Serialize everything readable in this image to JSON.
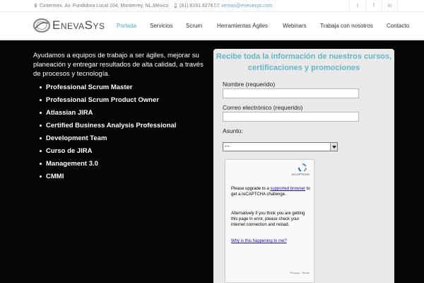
{
  "topbar": {
    "address": "Cintermex. Av. Fundidora Local 104, Monterrey, NL,México",
    "phone": "(81) 8191 8276",
    "email": "ventas@enevasys.com",
    "social": [
      {
        "name": "twitter-icon",
        "glyph": "t"
      },
      {
        "name": "facebook-icon",
        "glyph": "f"
      },
      {
        "name": "linkedin-icon",
        "glyph": "in"
      }
    ]
  },
  "header": {
    "logo_text": "EnevaSys",
    "nav": [
      "Portada",
      "Servicios",
      "Scrum",
      "Herramientas Ágiles",
      "Webinars",
      "Trabaja con nosotros",
      "Contacto"
    ],
    "active_index": 0,
    "accent_color": "#4ab2c3"
  },
  "main": {
    "intro": "Ayudamos a equipos de trabajo a ser ágiles, mejorar su planeación y entregar resultados de alta calidad, a través de procesos y tecnología.",
    "items": [
      "Professional Scrum Master",
      "Professional Scrum Product Owner",
      "Atlassian JIRA",
      "Certified Business Analysis Professional",
      "Development Team",
      "Curso de JIRA",
      "Management 3.0",
      "CMMI"
    ]
  },
  "form": {
    "title": "Recibe toda la información de nuestros cursos, certificaciones y promociones",
    "name_label": "Nombre (requerido)",
    "name_value": "",
    "email_label": "Correo electrónico (requerido)",
    "email_value": "",
    "subject_label": "Asunto:",
    "subject_value": "---",
    "title_color": "#63b6c6"
  },
  "captcha": {
    "brand": "reCAPTCHA",
    "msg1_pre": "Please upgrade to a ",
    "msg1_link": "supported browser",
    "msg1_post": " to get a reCAPTCHA challenge.",
    "msg2": "Alternatively if you think you are getting this page in error, please check your internet connection and reload.",
    "msg3_link": "Why is this happening to me?",
    "footer": "Privacy - Terms"
  }
}
